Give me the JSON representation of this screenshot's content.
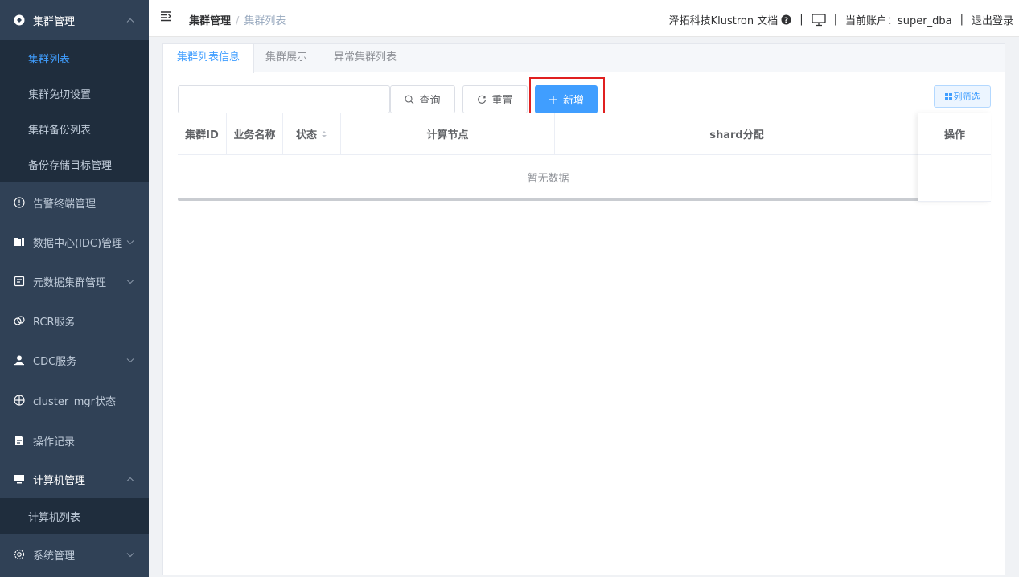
{
  "sidebar": {
    "items": [
      {
        "label": "集群管理",
        "icon": "cluster-icon",
        "chevron": "up"
      },
      {
        "label": "告警终端管理",
        "icon": "alert-circle-icon"
      },
      {
        "label": "数据中心(IDC)管理",
        "icon": "datacenter-icon",
        "chevron": "down"
      },
      {
        "label": "元数据集群管理",
        "icon": "metadata-icon",
        "chevron": "down"
      },
      {
        "label": "RCR服务",
        "icon": "rcr-icon"
      },
      {
        "label": "CDC服务",
        "icon": "user-icon",
        "chevron": "down"
      },
      {
        "label": "cluster_mgr状态",
        "icon": "crosshair-icon"
      },
      {
        "label": "操作记录",
        "icon": "record-icon"
      },
      {
        "label": "计算机管理",
        "icon": "monitor-icon",
        "chevron": "up"
      },
      {
        "label": "系统管理",
        "icon": "settings-icon",
        "chevron": "down"
      }
    ],
    "cluster_sub": [
      "集群列表",
      "集群免切设置",
      "集群备份列表",
      "备份存储目标管理"
    ],
    "computer_sub": [
      "计算机列表"
    ]
  },
  "header": {
    "breadcrumb": [
      "集群管理",
      "集群列表"
    ],
    "docs_label": "泽拓科技Klustron 文档",
    "account_label": "当前账户：super_dba",
    "logout_label": "退出登录",
    "separator": "|"
  },
  "tabs": [
    "集群列表信息",
    "集群展示",
    "异常集群列表"
  ],
  "toolbar": {
    "search_value": "",
    "query_label": "查询",
    "reset_label": "重置",
    "add_label": "新增",
    "column_filter_label": "列筛选"
  },
  "table": {
    "columns": [
      "集群ID",
      "业务名称",
      "状态",
      "计算节点",
      "shard分配",
      "操作"
    ],
    "empty_text": "暂无数据"
  },
  "colors": {
    "sidebar_bg": "#304156",
    "submenu_bg": "#1f2d3d",
    "accent": "#409eff",
    "highlight_border": "#e02020"
  }
}
